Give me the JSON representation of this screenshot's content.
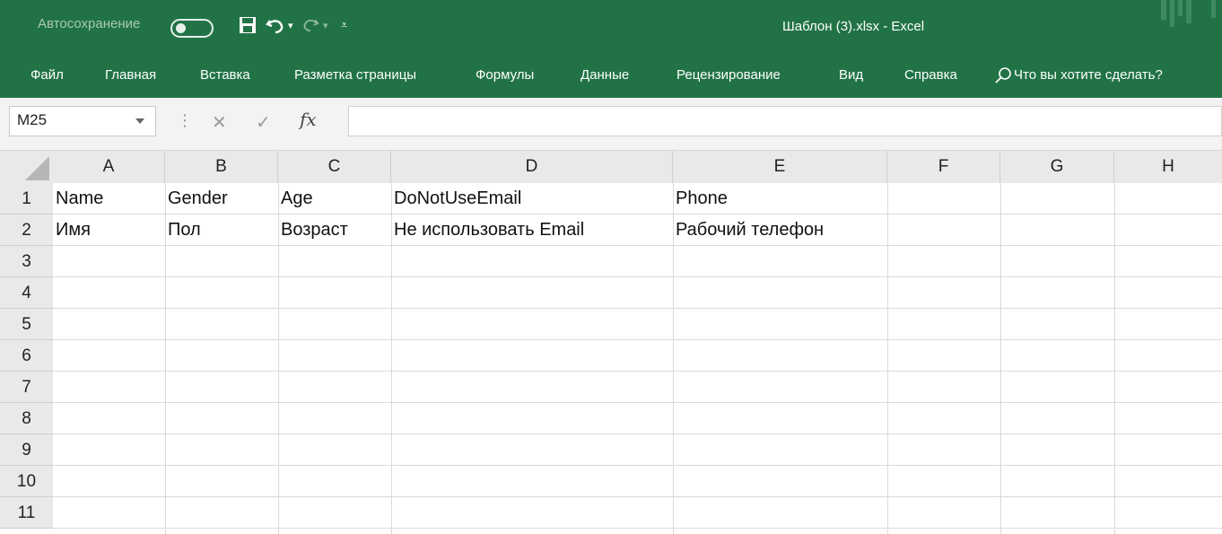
{
  "title_bar": {
    "autosave_label": "Автосохранение",
    "document_title": "Шаблон (3).xlsx  -  Excel"
  },
  "ribbon": {
    "tabs": [
      "Файл",
      "Главная",
      "Вставка",
      "Разметка страницы",
      "Формулы",
      "Данные",
      "Рецензирование",
      "Вид",
      "Справка"
    ],
    "search_placeholder": "Что вы хотите сделать?"
  },
  "formula_bar": {
    "name_box": "M25",
    "fx_label": "fx",
    "formula_value": ""
  },
  "sheet": {
    "columns": [
      "A",
      "B",
      "C",
      "D",
      "E",
      "F",
      "G",
      "H"
    ],
    "rows": [
      "1",
      "2",
      "3",
      "4",
      "5",
      "6",
      "7",
      "8",
      "9",
      "10",
      "11"
    ],
    "cells": {
      "A1": "Name",
      "B1": "Gender",
      "C1": "Age",
      "D1": "DoNotUseEmail",
      "E1": "Phone",
      "A2": "Имя",
      "B2": "Пол",
      "C2": "Возраст",
      "D2": "Не использовать Email",
      "E2": "Рабочий телефон"
    }
  },
  "colors": {
    "brand_green": "#217346",
    "header_gray": "#e9e9e9",
    "grid_line": "#dadada"
  }
}
